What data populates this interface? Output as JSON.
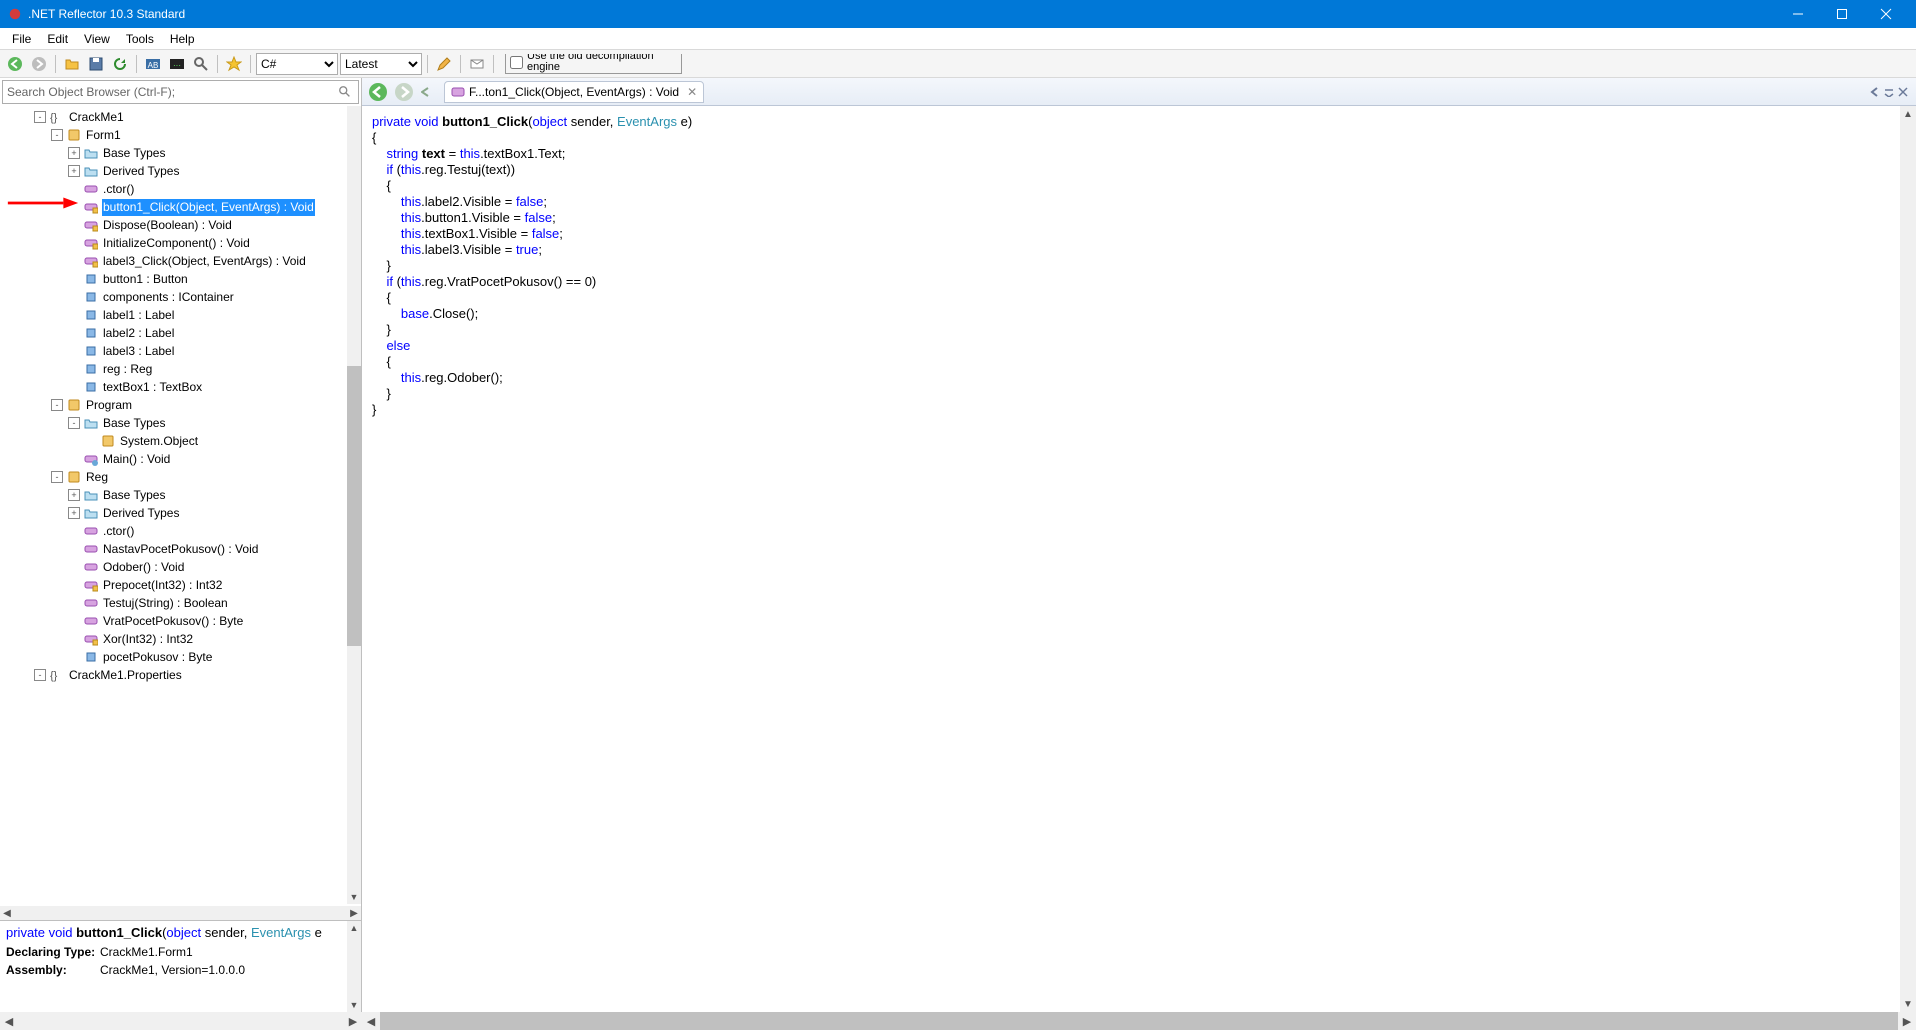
{
  "title": ".NET Reflector 10.3 Standard",
  "menus": [
    "File",
    "Edit",
    "View",
    "Tools",
    "Help"
  ],
  "toolbar": {
    "lang_options": [
      "C#"
    ],
    "lang_selected": "C#",
    "ver_options": [
      "Latest"
    ],
    "ver_selected": "Latest",
    "engine_label": "Use the old decompilation engine"
  },
  "search_placeholder": "Search Object Browser (Ctrl-F);",
  "tree": [
    {
      "indent": 2,
      "exp": "-",
      "icon": "ns",
      "label": "CrackMe1"
    },
    {
      "indent": 3,
      "exp": "-",
      "icon": "class",
      "label": "Form1"
    },
    {
      "indent": 4,
      "exp": "+",
      "icon": "folder",
      "label": "Base Types"
    },
    {
      "indent": 4,
      "exp": "+",
      "icon": "folder",
      "label": "Derived Types"
    },
    {
      "indent": 4,
      "exp": " ",
      "icon": "method",
      "label": ".ctor()"
    },
    {
      "indent": 4,
      "exp": " ",
      "icon": "methodp",
      "label": "button1_Click(Object, EventArgs) : Void",
      "selected": true
    },
    {
      "indent": 4,
      "exp": " ",
      "icon": "methodp",
      "label": "Dispose(Boolean) : Void"
    },
    {
      "indent": 4,
      "exp": " ",
      "icon": "methodp",
      "label": "InitializeComponent() : Void"
    },
    {
      "indent": 4,
      "exp": " ",
      "icon": "methodp",
      "label": "label3_Click(Object, EventArgs) : Void"
    },
    {
      "indent": 4,
      "exp": " ",
      "icon": "field",
      "label": "button1 : Button"
    },
    {
      "indent": 4,
      "exp": " ",
      "icon": "field",
      "label": "components : IContainer"
    },
    {
      "indent": 4,
      "exp": " ",
      "icon": "field",
      "label": "label1 : Label"
    },
    {
      "indent": 4,
      "exp": " ",
      "icon": "field",
      "label": "label2 : Label"
    },
    {
      "indent": 4,
      "exp": " ",
      "icon": "field",
      "label": "label3 : Label"
    },
    {
      "indent": 4,
      "exp": " ",
      "icon": "field",
      "label": "reg : Reg"
    },
    {
      "indent": 4,
      "exp": " ",
      "icon": "field",
      "label": "textBox1 : TextBox"
    },
    {
      "indent": 3,
      "exp": "-",
      "icon": "class",
      "label": "Program"
    },
    {
      "indent": 4,
      "exp": "-",
      "icon": "folder",
      "label": "Base Types"
    },
    {
      "indent": 5,
      "exp": " ",
      "icon": "class",
      "label": "System.Object"
    },
    {
      "indent": 4,
      "exp": " ",
      "icon": "methods",
      "label": "Main() : Void"
    },
    {
      "indent": 3,
      "exp": "-",
      "icon": "class",
      "label": "Reg"
    },
    {
      "indent": 4,
      "exp": "+",
      "icon": "folder",
      "label": "Base Types"
    },
    {
      "indent": 4,
      "exp": "+",
      "icon": "folder",
      "label": "Derived Types"
    },
    {
      "indent": 4,
      "exp": " ",
      "icon": "method",
      "label": ".ctor()"
    },
    {
      "indent": 4,
      "exp": " ",
      "icon": "method",
      "label": "NastavPocetPokusov() : Void"
    },
    {
      "indent": 4,
      "exp": " ",
      "icon": "method",
      "label": "Odober() : Void"
    },
    {
      "indent": 4,
      "exp": " ",
      "icon": "methodp",
      "label": "Prepocet(Int32) : Int32"
    },
    {
      "indent": 4,
      "exp": " ",
      "icon": "method",
      "label": "Testuj(String) : Boolean"
    },
    {
      "indent": 4,
      "exp": " ",
      "icon": "method",
      "label": "VratPocetPokusov() : Byte"
    },
    {
      "indent": 4,
      "exp": " ",
      "icon": "methodp",
      "label": "Xor(Int32) : Int32"
    },
    {
      "indent": 4,
      "exp": " ",
      "icon": "field",
      "label": "pocetPokusov : Byte"
    },
    {
      "indent": 2,
      "exp": "-",
      "icon": "ns",
      "label": "CrackMe1.Properties"
    }
  ],
  "tab_label": "F...ton1_Click(Object, EventArgs) : Void",
  "details": {
    "declaring_label": "Declaring Type:",
    "declaring_value": "CrackMe1.Form1",
    "assembly_label": "Assembly:",
    "assembly_value": "CrackMe1, Version=1.0.0.0"
  },
  "signature_tokens": [
    {
      "t": "private ",
      "c": "kw"
    },
    {
      "t": "void ",
      "c": "kw"
    },
    {
      "t": "button1_Click",
      "c": "nm"
    },
    {
      "t": "(",
      "c": ""
    },
    {
      "t": "object ",
      "c": "kw"
    },
    {
      "t": "sender, ",
      "c": ""
    },
    {
      "t": "EventArgs ",
      "c": "typ"
    },
    {
      "t": "e",
      "c": ""
    }
  ],
  "code_lines": [
    [
      {
        "t": "private",
        "c": "kw"
      },
      {
        "t": " "
      },
      {
        "t": "void",
        "c": "kw"
      },
      {
        "t": " "
      },
      {
        "t": "button1_Click",
        "b": true
      },
      {
        "t": "("
      },
      {
        "t": "object",
        "c": "kw"
      },
      {
        "t": " sender, "
      },
      {
        "t": "EventArgs",
        "c": "typ"
      },
      {
        "t": " e)"
      }
    ],
    [
      {
        "t": "{"
      }
    ],
    [
      {
        "t": "    "
      },
      {
        "t": "string",
        "c": "kw"
      },
      {
        "t": " "
      },
      {
        "t": "text",
        "b": true
      },
      {
        "t": " = "
      },
      {
        "t": "this",
        "c": "kw"
      },
      {
        "t": ".textBox1.Text;"
      }
    ],
    [
      {
        "t": "    "
      },
      {
        "t": "if",
        "c": "kw"
      },
      {
        "t": " ("
      },
      {
        "t": "this",
        "c": "kw"
      },
      {
        "t": ".reg.Testuj(text))"
      }
    ],
    [
      {
        "t": "    {"
      }
    ],
    [
      {
        "t": "        "
      },
      {
        "t": "this",
        "c": "kw"
      },
      {
        "t": ".label2.Visible = "
      },
      {
        "t": "false",
        "c": "kw"
      },
      {
        "t": ";"
      }
    ],
    [
      {
        "t": "        "
      },
      {
        "t": "this",
        "c": "kw"
      },
      {
        "t": ".button1.Visible = "
      },
      {
        "t": "false",
        "c": "kw"
      },
      {
        "t": ";"
      }
    ],
    [
      {
        "t": "        "
      },
      {
        "t": "this",
        "c": "kw"
      },
      {
        "t": ".textBox1.Visible = "
      },
      {
        "t": "false",
        "c": "kw"
      },
      {
        "t": ";"
      }
    ],
    [
      {
        "t": "        "
      },
      {
        "t": "this",
        "c": "kw"
      },
      {
        "t": ".label3.Visible = "
      },
      {
        "t": "true",
        "c": "kw"
      },
      {
        "t": ";"
      }
    ],
    [
      {
        "t": "    }"
      }
    ],
    [
      {
        "t": "    "
      },
      {
        "t": "if",
        "c": "kw"
      },
      {
        "t": " ("
      },
      {
        "t": "this",
        "c": "kw"
      },
      {
        "t": ".reg.VratPocetPokusov() == "
      },
      {
        "t": "0",
        "c": "num"
      },
      {
        "t": ")"
      }
    ],
    [
      {
        "t": "    {"
      }
    ],
    [
      {
        "t": "        "
      },
      {
        "t": "base",
        "c": "kw"
      },
      {
        "t": ".Close();"
      }
    ],
    [
      {
        "t": "    }"
      }
    ],
    [
      {
        "t": "    "
      },
      {
        "t": "else",
        "c": "kw"
      }
    ],
    [
      {
        "t": "    {"
      }
    ],
    [
      {
        "t": "        "
      },
      {
        "t": "this",
        "c": "kw"
      },
      {
        "t": ".reg.Odober();"
      }
    ],
    [
      {
        "t": "    }"
      }
    ],
    [
      {
        "t": "}"
      }
    ]
  ]
}
